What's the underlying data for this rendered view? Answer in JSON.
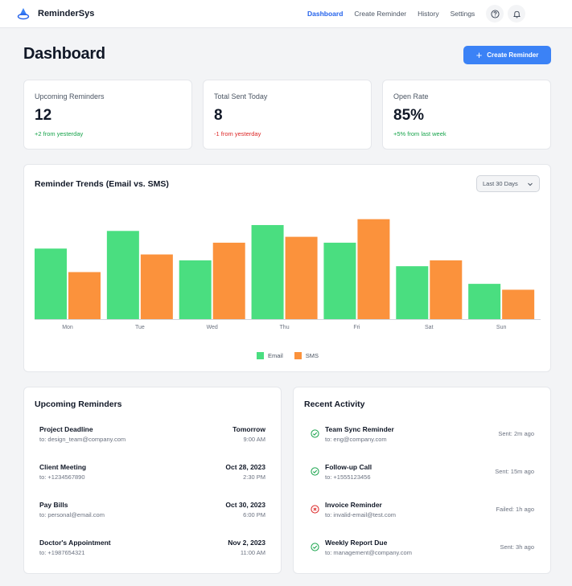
{
  "app": {
    "name": "ReminderSys"
  },
  "nav": {
    "links": [
      {
        "label": "Dashboard",
        "active": true
      },
      {
        "label": "Create Reminder",
        "active": false
      },
      {
        "label": "History",
        "active": false
      },
      {
        "label": "Settings",
        "active": false
      }
    ],
    "icons": [
      "help-icon",
      "bell-icon"
    ]
  },
  "header": {
    "title": "Dashboard",
    "create_label": "Create Reminder"
  },
  "stats": [
    {
      "label": "Upcoming Reminders",
      "value": "12",
      "change": "+2 from yesterday",
      "trend": "up"
    },
    {
      "label": "Total Sent Today",
      "value": "8",
      "change": "-1 from yesterday",
      "trend": "down"
    },
    {
      "label": "Open Rate",
      "value": "85%",
      "change": "+5% from last week",
      "trend": "up"
    }
  ],
  "chart_section": {
    "range_value": "Last 30 Days"
  },
  "chart_data": {
    "type": "bar",
    "title": "Reminder Trends (Email vs. SMS)",
    "categories": [
      "Mon",
      "Tue",
      "Wed",
      "Thu",
      "Fri",
      "Sat",
      "Sun"
    ],
    "series": [
      {
        "name": "Email",
        "color": "#4ade80",
        "values": [
          120,
          150,
          100,
          160,
          130,
          90,
          60
        ]
      },
      {
        "name": "SMS",
        "color": "#fb923c",
        "values": [
          80,
          110,
          130,
          140,
          170,
          100,
          50
        ]
      }
    ],
    "ylim": [
      0,
      175
    ],
    "grid": false,
    "legend": "bottom-center"
  },
  "upcoming": {
    "title": "Upcoming Reminders",
    "items": [
      {
        "title": "Project Deadline",
        "to": "to: design_team@company.com",
        "date": "Tomorrow",
        "time": "9:00 AM"
      },
      {
        "title": "Client Meeting",
        "to": "to: +1234567890",
        "date": "Oct 28, 2023",
        "time": "2:30 PM"
      },
      {
        "title": "Pay Bills",
        "to": "to: personal@email.com",
        "date": "Oct 30, 2023",
        "time": "6:00 PM"
      },
      {
        "title": "Doctor's Appointment",
        "to": "to: +1987654321",
        "date": "Nov 2, 2023",
        "time": "11:00 AM"
      }
    ]
  },
  "activity": {
    "title": "Recent Activity",
    "items": [
      {
        "title": "Team Sync Reminder",
        "to": "to: eng@company.com",
        "status": "Sent: 2m ago",
        "icon": "check-circle-icon",
        "color": "#16a34a"
      },
      {
        "title": "Follow-up Call",
        "to": "to: +1555123456",
        "status": "Sent: 15m ago",
        "icon": "check-circle-icon",
        "color": "#16a34a"
      },
      {
        "title": "Invoice Reminder",
        "to": "to: invalid-email@test.com",
        "status": "Failed: 1h ago",
        "icon": "x-circle-icon",
        "color": "#dc2626"
      },
      {
        "title": "Weekly Report Due",
        "to": "to: management@company.com",
        "status": "Sent: 3h ago",
        "icon": "check-circle-icon",
        "color": "#16a34a"
      }
    ]
  }
}
